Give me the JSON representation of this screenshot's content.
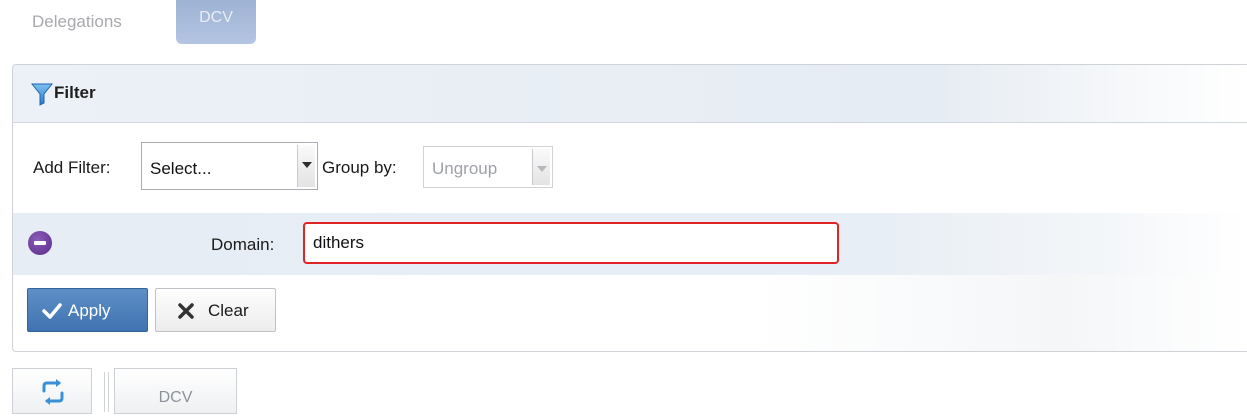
{
  "tabs": {
    "delegations": "Delegations",
    "dcv": "DCV"
  },
  "filter_panel": {
    "title": "Filter",
    "add_filter_label": "Add Filter:",
    "add_filter_select": "Select...",
    "group_by_label": "Group by:",
    "group_by_select": "Ungroup",
    "domain_label": "Domain:",
    "domain_value": "dithers",
    "apply_label": "Apply",
    "clear_label": "Clear"
  },
  "toolbar": {
    "dcv_label": "DCV"
  },
  "icons": {
    "filter": "funnel-icon",
    "remove": "minus-circle-icon",
    "apply": "check-icon",
    "clear": "x-icon",
    "refresh": "refresh-icon"
  },
  "colors": {
    "accent_blue": "#4a7dba",
    "error_border": "#e02424",
    "remove_purple": "#6a3a98",
    "funnel_blue": "#3b8fd6"
  }
}
